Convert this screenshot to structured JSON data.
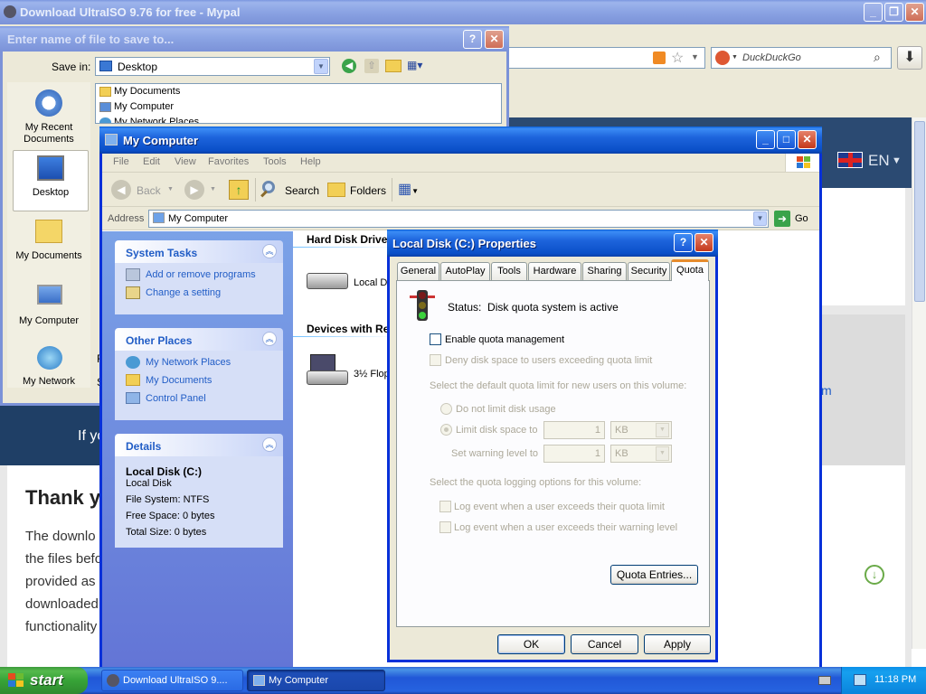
{
  "browser": {
    "title": "Download UltraISO 9.76 for free - Mypal",
    "search_placeholder": "DuckDuckGo",
    "lang": "EN",
    "page_text_if": "If yo",
    "heading": "Thank you",
    "para": [
      "The downlo",
      "the files befo",
      "provided as",
      "downloaded",
      "functionality"
    ],
    "link_tail": "m"
  },
  "save_dialog": {
    "title": "Enter name of file to save to...",
    "save_in_label": "Save in:",
    "save_in_value": "Desktop",
    "places": [
      "My Recent Documents",
      "Desktop",
      "My Documents",
      "My Computer",
      "My Network"
    ],
    "files": [
      "My Documents",
      "My Computer",
      "My Network Places"
    ],
    "side_letters": [
      "F",
      "S"
    ]
  },
  "explorer": {
    "title": "My Computer",
    "menu": [
      "File",
      "Edit",
      "View",
      "Favorites",
      "Tools",
      "Help"
    ],
    "toolbar": {
      "back": "Back",
      "search": "Search",
      "folders": "Folders"
    },
    "address_label": "Address",
    "address_value": "My Computer",
    "go": "Go",
    "system_tasks": {
      "title": "System Tasks",
      "items": [
        "Add or remove programs",
        "Change a setting"
      ]
    },
    "other_places": {
      "title": "Other Places",
      "items": [
        "My Network Places",
        "My Documents",
        "Control Panel"
      ]
    },
    "details": {
      "title": "Details",
      "name": "Local Disk (C:)",
      "type": "Local Disk",
      "fs": "File System: NTFS",
      "free": "Free Space: 0 bytes",
      "total": "Total Size: 0 bytes"
    },
    "group_hdd": "Hard Disk Drives",
    "group_removable": "Devices with Re",
    "hdd_item": "Local Di",
    "floppy_item": "3½ Flop"
  },
  "props": {
    "title": "Local Disk (C:) Properties",
    "tabs": [
      "General",
      "AutoPlay",
      "Tools",
      "Hardware",
      "Sharing",
      "Security",
      "Quota"
    ],
    "status": "Status:  Disk quota system is active",
    "enable": "Enable quota management",
    "deny": "Deny disk space to users exceeding quota limit",
    "select_default": "Select the default quota limit for new users on this volume:",
    "no_limit": "Do not limit disk usage",
    "limit_to": "Limit disk space to",
    "warn_to": "Set warning level to",
    "limit_val": "1",
    "warn_val": "1",
    "unit": "KB",
    "logging": "Select the quota logging options for this volume:",
    "log_limit": "Log event when a user exceeds their quota limit",
    "log_warn": "Log event when a user exceeds their warning level",
    "entries_btn": "Quota Entries...",
    "ok": "OK",
    "cancel": "Cancel",
    "apply": "Apply"
  },
  "taskbar": {
    "start": "start",
    "tasks": [
      "Download UltraISO 9....",
      "My Computer"
    ],
    "clock": "11:18 PM"
  }
}
